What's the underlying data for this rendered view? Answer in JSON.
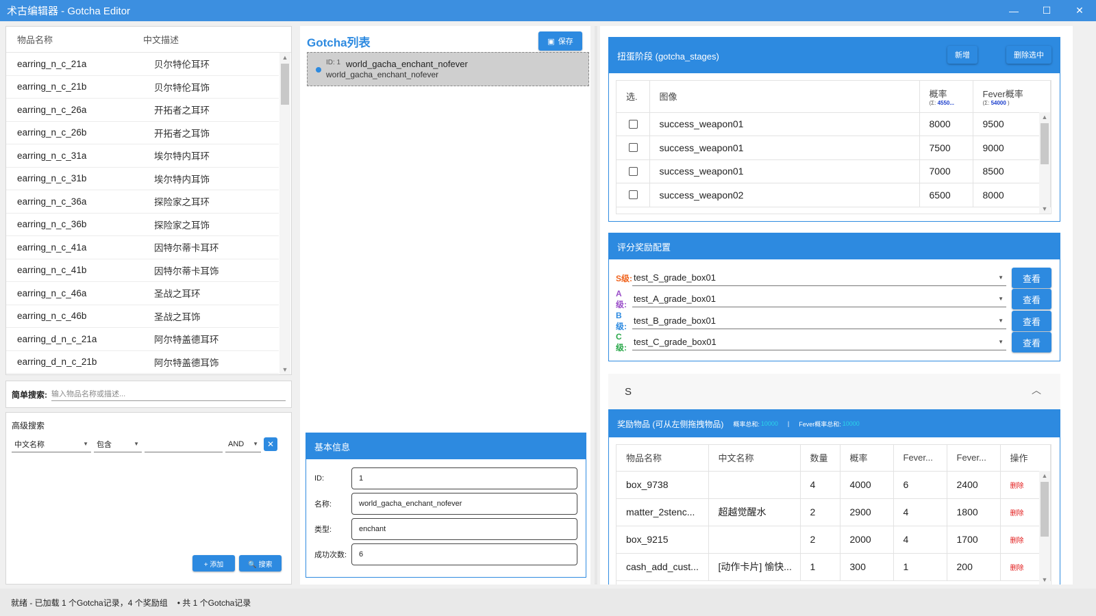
{
  "window": {
    "title": "术古编辑器 - Gotcha Editor",
    "minimize": "—",
    "maximize": "☐",
    "close": "✕"
  },
  "items_table": {
    "headers": {
      "name": "物品名称",
      "desc": "中文描述"
    },
    "rows": [
      {
        "name": "earring_n_c_21a",
        "desc": "贝尔特伦耳环"
      },
      {
        "name": "earring_n_c_21b",
        "desc": "贝尔特伦耳饰"
      },
      {
        "name": "earring_n_c_26a",
        "desc": "开拓者之耳环"
      },
      {
        "name": "earring_n_c_26b",
        "desc": "开拓者之耳饰"
      },
      {
        "name": "earring_n_c_31a",
        "desc": "埃尔特内耳环"
      },
      {
        "name": "earring_n_c_31b",
        "desc": "埃尔特内耳饰"
      },
      {
        "name": "earring_n_c_36a",
        "desc": "探险家之耳环"
      },
      {
        "name": "earring_n_c_36b",
        "desc": "探险家之耳饰"
      },
      {
        "name": "earring_n_c_41a",
        "desc": "因特尔蒂卡耳环"
      },
      {
        "name": "earring_n_c_41b",
        "desc": "因特尔蒂卡耳饰"
      },
      {
        "name": "earring_n_c_46a",
        "desc": "圣战之耳环"
      },
      {
        "name": "earring_n_c_46b",
        "desc": "圣战之耳饰"
      },
      {
        "name": "earring_d_n_c_21a",
        "desc": "阿尔特盖德耳环"
      },
      {
        "name": "earring_d_n_c_21b",
        "desc": "阿尔特盖德耳饰"
      }
    ]
  },
  "simple_search": {
    "label": "简单搜索:",
    "placeholder": "输入物品名称或描述..."
  },
  "advanced_search": {
    "title": "高级搜索",
    "field": "中文名称",
    "operator": "包含",
    "value": "",
    "logic": "AND",
    "add_label": "+ 添加",
    "search_label": "🔍 搜索"
  },
  "gotcha_list": {
    "title": "Gotcha列表",
    "save_label": "保存",
    "items": [
      {
        "id_label": "ID: 1",
        "name": "world_gacha_enchant_nofever",
        "sub": "world_gacha_enchant_nofever"
      }
    ]
  },
  "basic_info": {
    "title": "基本信息",
    "fields": [
      {
        "label": "ID:",
        "value": "1"
      },
      {
        "label": "名称:",
        "value": "world_gacha_enchant_nofever"
      },
      {
        "label": "类型:",
        "value": "enchant"
      },
      {
        "label": "成功次数:",
        "value": "6"
      }
    ]
  },
  "stages": {
    "title": "扭蛋阶段 (gotcha_stages)",
    "add_label": "新增",
    "delete_label": "删除选中",
    "headers": {
      "select": "选.",
      "image": "图像",
      "prob": "概率",
      "prob_sum_prefix": "(Σ: ",
      "prob_sum": "4550...",
      "fever": "Fever概率",
      "fever_sum_prefix": "(Σ: ",
      "fever_sum": "54000",
      "sum_suffix": ")"
    },
    "rows": [
      {
        "image": "success_weapon01",
        "prob": "8000",
        "fever": "9500"
      },
      {
        "image": "success_weapon01",
        "prob": "7500",
        "fever": "9000"
      },
      {
        "image": "success_weapon01",
        "prob": "7000",
        "fever": "8500"
      },
      {
        "image": "success_weapon02",
        "prob": "6500",
        "fever": "8000"
      }
    ]
  },
  "grade_rewards": {
    "title": "评分奖励配置",
    "view_label": "查看",
    "grades": [
      {
        "label": "S级:",
        "value": "test_S_grade_box01",
        "color": "#f0641e"
      },
      {
        "label": "A级:",
        "value": "test_A_grade_box01",
        "color": "#9b4fc9"
      },
      {
        "label": "B级:",
        "value": "test_B_grade_box01",
        "color": "#2d8ae0"
      },
      {
        "label": "C级:",
        "value": "test_C_grade_box01",
        "color": "#2aa84a"
      }
    ]
  },
  "s_section": {
    "title": "S"
  },
  "reward_items": {
    "title": "奖励物品 (可从左侧拖拽物品)",
    "prob_total_label": "概率总和:",
    "prob_total": "10000",
    "separator": "|",
    "fever_total_label": "Fever概率总和:",
    "fever_total": "10000",
    "headers": [
      "物品名称",
      "中文名称",
      "数量",
      "概率",
      "Fever...",
      "Fever...",
      "操作"
    ],
    "delete_label": "删除",
    "rows": [
      {
        "name": "box_9738",
        "cn": "",
        "qty": "4",
        "prob": "4000",
        "fever_qty": "6",
        "fever_prob": "2400"
      },
      {
        "name": "matter_2stenc...",
        "cn": "超越觉醒水",
        "qty": "2",
        "prob": "2900",
        "fever_qty": "4",
        "fever_prob": "1800"
      },
      {
        "name": "box_9215",
        "cn": "",
        "qty": "2",
        "prob": "2000",
        "fever_qty": "4",
        "fever_prob": "1700"
      },
      {
        "name": "cash_add_cust...",
        "cn": "[动作卡片] 愉快...",
        "qty": "1",
        "prob": "300",
        "fever_qty": "1",
        "fever_prob": "200"
      }
    ]
  },
  "status": {
    "text": "就绪 - 已加载 1 个Gotcha记录，4 个奖励组",
    "extra": "• 共 1 个Gotcha记录"
  },
  "colors": {
    "accent": "#2d8ae0",
    "titlebar": "#3c8fe0",
    "delete": "#e21b1b",
    "sum_cyan": "#29d4e8"
  }
}
